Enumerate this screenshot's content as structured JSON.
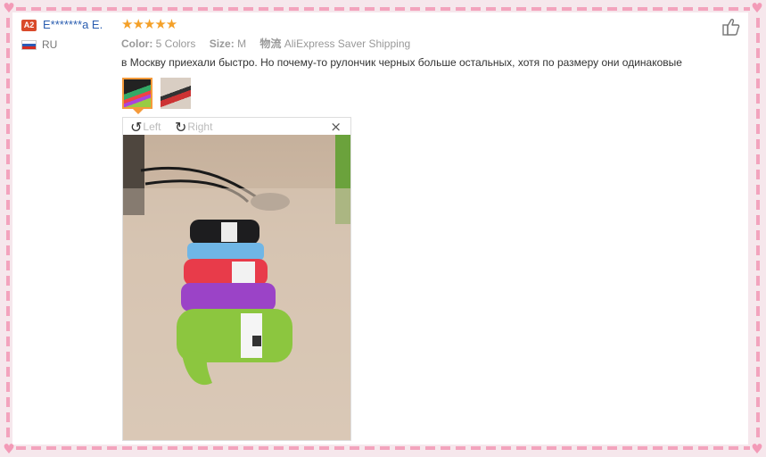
{
  "reviewer": {
    "badge": "A2",
    "name": "E*******a E.",
    "country": "RU",
    "flag_colors": [
      "#ffffff",
      "#2a5bb6",
      "#d52b1e"
    ]
  },
  "rating": {
    "stars": "★★★★★",
    "value": 5,
    "max": 5,
    "color": "#f4a028"
  },
  "meta": {
    "color_label": "Color:",
    "color_value": "5 Colors",
    "size_label": "Size:",
    "size_value": "M",
    "shipping_label": "物流",
    "shipping_value": "AliExpress Saver Shipping"
  },
  "review_text": "в Москву приехали быстро. Но почему-то рулончик черных больше остальных, хотя по размеру они одинаковые",
  "viewer": {
    "rotate_left_label": "Left",
    "rotate_right_label": "Right",
    "rotate_left_icon": "↺",
    "rotate_right_icon": "↻",
    "close_icon": "×"
  },
  "photo": {
    "description_free": true,
    "roll_colors": [
      "#1d1d1f",
      "#6fb6e6",
      "#e83b4a",
      "#9b43c7",
      "#8cc63f"
    ]
  },
  "icons": {
    "like": "thumbs-up-icon",
    "heart": "♥"
  },
  "colors": {
    "accent_border": "#f3a3bd",
    "link": "#2a5db0",
    "selected_thumb": "#f59a3a"
  }
}
